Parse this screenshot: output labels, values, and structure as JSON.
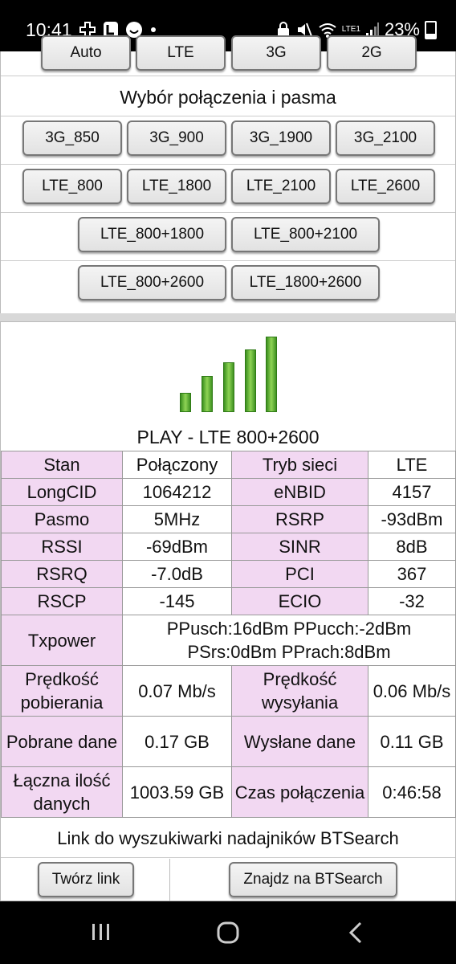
{
  "status": {
    "time": "10:41",
    "battery": "23%",
    "network": "LTE1"
  },
  "band_section": {
    "top_row_partial": [
      "Auto",
      "LTE",
      "3G",
      "2G"
    ],
    "title": "Wybór połączenia i pasma",
    "row1": [
      "3G_850",
      "3G_900",
      "3G_1900",
      "3G_2100"
    ],
    "row2": [
      "LTE_800",
      "LTE_1800",
      "LTE_2100",
      "LTE_2600"
    ],
    "row3": [
      "LTE_800+1800",
      "LTE_800+2100"
    ],
    "row4": [
      "LTE_800+2600",
      "LTE_1800+2600"
    ]
  },
  "signal": {
    "bars_filled": 5,
    "bars_total": 5,
    "operator": "PLAY - LTE 800+2600"
  },
  "info_table": {
    "r1": {
      "l1": "Stan",
      "v1": "Połączony",
      "l2": "Tryb sieci",
      "v2": "LTE"
    },
    "r2": {
      "l1": "LongCID",
      "v1": "1064212",
      "l2": "eNBID",
      "v2": "4157"
    },
    "r3": {
      "l1": "Pasmo",
      "v1": "5MHz",
      "l2": "RSRP",
      "v2": "-93dBm"
    },
    "r4": {
      "l1": "RSSI",
      "v1": "-69dBm",
      "l2": "SINR",
      "v2": "8dB"
    },
    "r5": {
      "l1": "RSRQ",
      "v1": "-7.0dB",
      "l2": "PCI",
      "v2": "367"
    },
    "r6": {
      "l1": "RSCP",
      "v1": "-145",
      "l2": "ECIO",
      "v2": "-32"
    },
    "txpower": {
      "label": "Txpower",
      "line1": "PPusch:16dBm PPucch:-2dBm",
      "line2": "PSrs:0dBm PPrach:8dBm"
    },
    "r8": {
      "l1": "Prędkość pobierania",
      "v1": "0.07 Mb/s",
      "l2": "Prędkość wysyłania",
      "v2": "0.06 Mb/s"
    },
    "r9": {
      "l1": "Pobrane dane",
      "v1": "0.17 GB",
      "l2": "Wysłane dane",
      "v2": "0.11 GB"
    },
    "r10": {
      "l1": "Łączna ilość danych",
      "v1": "1003.59 GB",
      "l2": "Czas połączenia",
      "v2": "0:46:58"
    }
  },
  "btsearch": {
    "title": "Link do wyszukiwarki nadajników BTSearch",
    "create_link": "Twórz link",
    "find": "Znajdz na BTSearch"
  }
}
